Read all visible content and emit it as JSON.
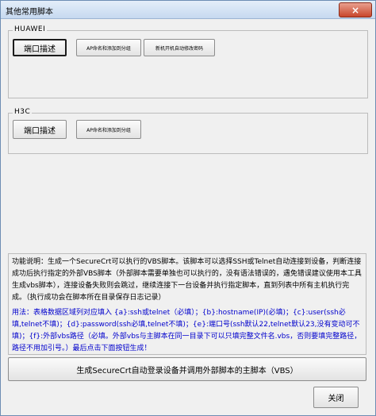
{
  "window": {
    "title": "其他常用脚本",
    "close_glyph": "×"
  },
  "huawei": {
    "title": "HUAWEI",
    "port_desc": "端口描述",
    "ap_name": "AP命名和添加到分组",
    "new_device": "新机开机自动修改密码"
  },
  "h3c": {
    "title": "H3C",
    "port_desc": "端口描述",
    "ap_name": "AP命名和添加到分组"
  },
  "description": {
    "function": "功能说明：生成一个SecureCrt可以执行的VBS脚本。该脚本可以选择SSH或Telnet自动连接到设备，判断连接成功后执行指定的外部VBS脚本（外部脚本需要单独也可以执行的，没有语法错误的，遇免错误建议使用本工具生成vbs脚本），连接设备失败则会跳过，继续连接下一台设备并执行指定脚本，直到列表中所有主机执行完成。（执行成功会在脚本所在目录保存日志记录）",
    "usage": "用法：表格数据区域列对应填入 {a}:ssh或telnet（必填）；{b}:hostname(IP)(必填)；{c}:user(ssh必填,telnet不填)；{d}:password(ssh必填,telnet不填)；{e}:端口号(ssh默认22,telnet默认23,没有变动可不填)；{f}:外部vbs路径（必填。外部vbs与主脚本在同一目录下可以只填完整文件名.vbs，否则要填完整路径，路径不用加引号。）最后点击下面按钮生成！"
  },
  "buttons": {
    "generate": "生成SecureCrt自动登录设备并调用外部脚本的主脚本（VBS）",
    "exit": "关闭"
  }
}
